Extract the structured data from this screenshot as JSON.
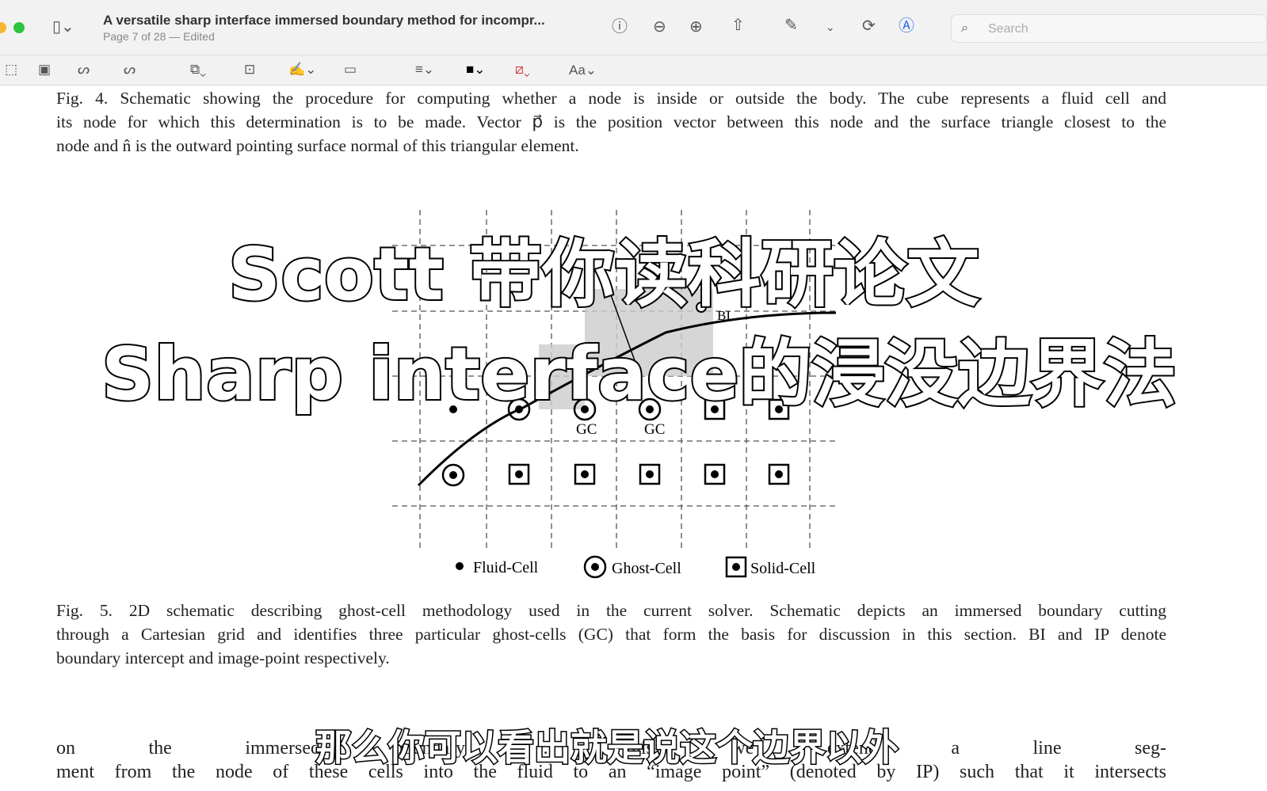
{
  "window": {
    "title": "A versatile sharp interface immersed boundary method for incompr...",
    "subtitle": "Page 7 of 28 — Edited",
    "search_placeholder": "Search"
  },
  "toolbar": {
    "font_label": "Aa"
  },
  "document": {
    "fig4_caption": [
      "Fig. 4.  Schematic showing the procedure for computing whether a node is inside or outside the body. The cube represents a fluid cell and",
      "its node for which this determination is to be made. Vector p⃗ is the position vector between this node and the surface triangle closest to the",
      "node and n̂ is the outward pointing surface normal of this triangular element."
    ],
    "figure_labels": {
      "gc1": "GC",
      "gc2": "GC",
      "bi": "BI"
    },
    "legend": {
      "fluid": "Fluid-Cell",
      "ghost": "Ghost-Cell",
      "solid": "Solid-Cell"
    },
    "fig5_caption": [
      "Fig. 5.  2D schematic describing ghost-cell methodology used in the current solver. Schematic depicts an immersed boundary cutting",
      "through a Cartesian grid and identifies three particular ghost-cells (GC) that form the basis for discussion in this section. BI and IP denote",
      "boundary intercept and image-point respectively."
    ],
    "body_text": [
      "on the immersed boundary ... this, we extend a line seg-",
      "ment from the node of these cells into the fluid to an “image point” (denoted by IP) such that it intersects"
    ]
  },
  "video_overlay": {
    "title_line1": "Scott 带你读科研论文",
    "title_line2": "Sharp interface的浸没边界法",
    "subtitle": "那么你可以看出就是说这个边界以外"
  }
}
